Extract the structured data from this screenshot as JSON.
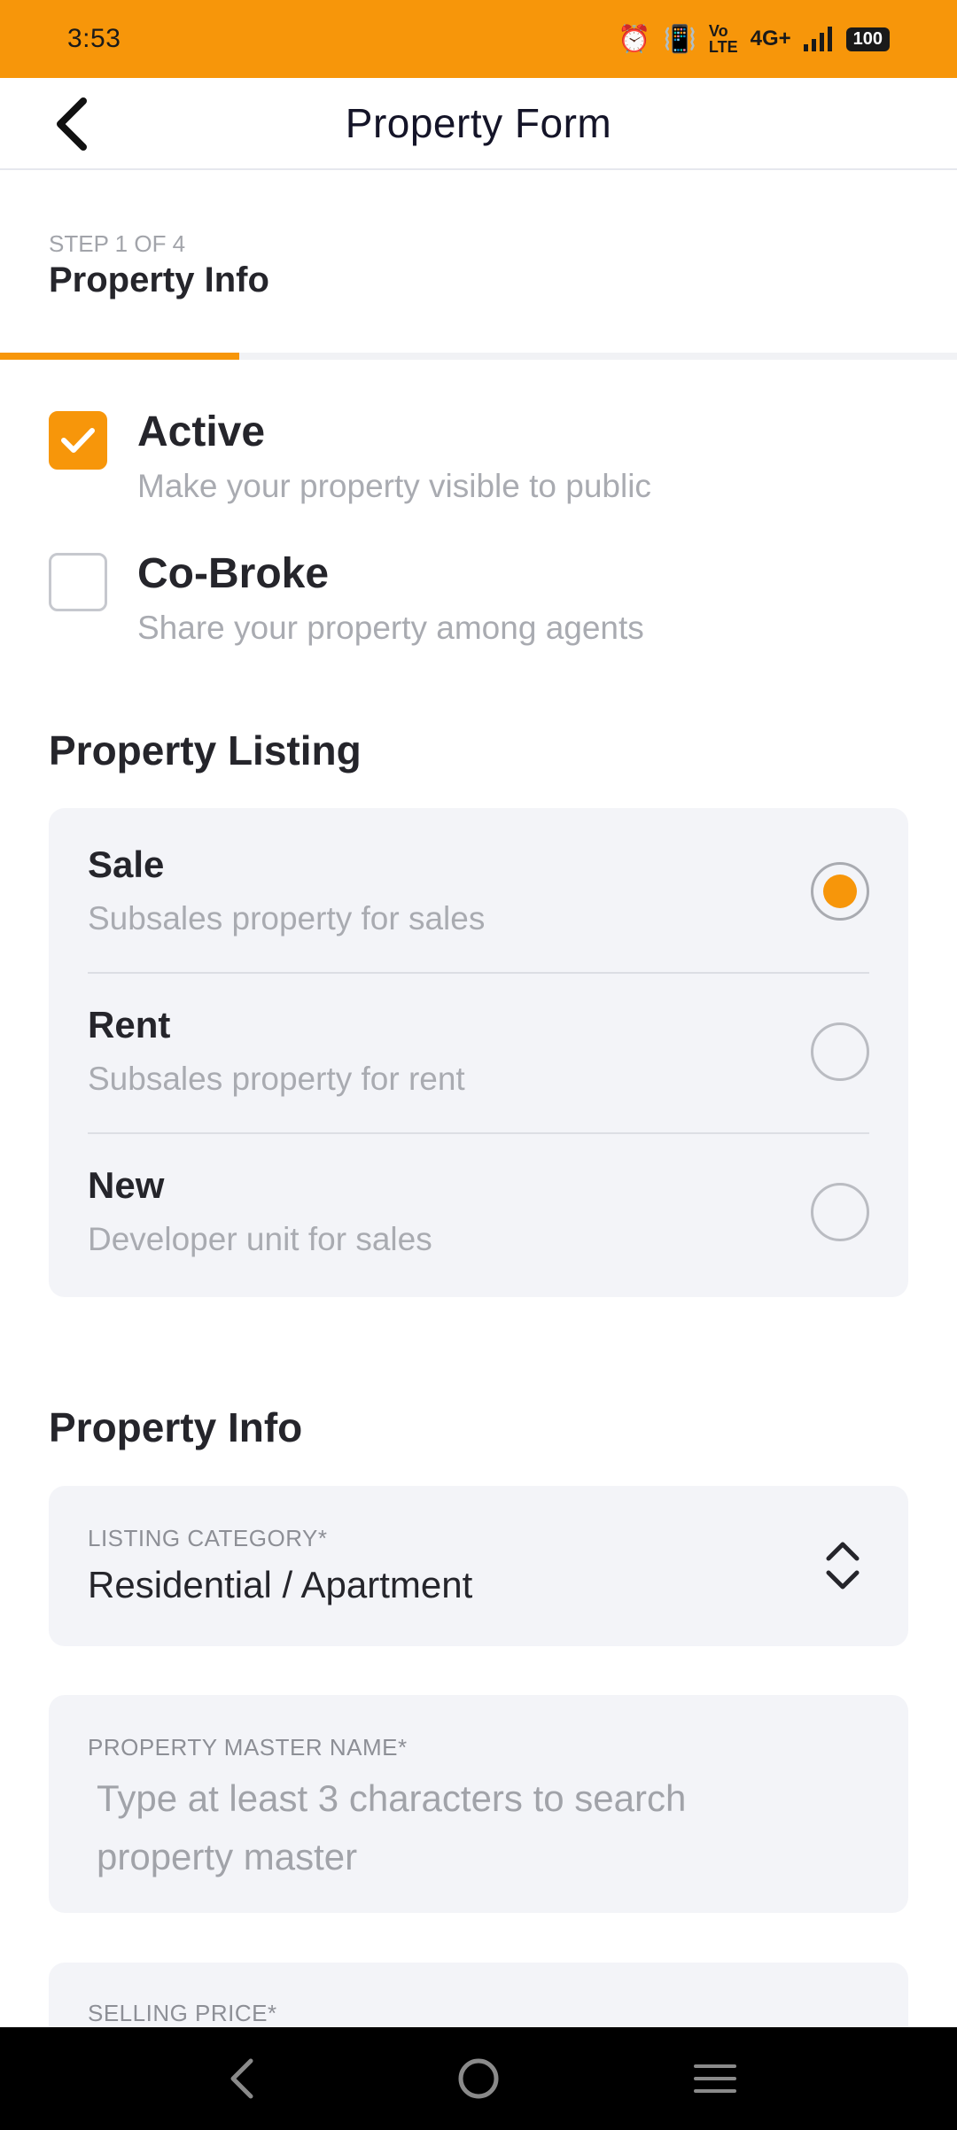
{
  "status_bar": {
    "time": "3:53",
    "network": "4G+",
    "battery": "100",
    "icons": [
      "alarm-icon",
      "vibrate-icon",
      "volte-icon",
      "signal-icon",
      "battery-icon"
    ]
  },
  "app_bar": {
    "title": "Property Form",
    "back_icon": "chevron-left-icon"
  },
  "step": {
    "label": "STEP 1 OF 4",
    "title": "Property Info",
    "progress_fraction": 0.25
  },
  "options": {
    "active": {
      "title": "Active",
      "subtitle": "Make your property visible to public",
      "checked": true
    },
    "cobroke": {
      "title": "Co-Broke",
      "subtitle": "Share your property among agents",
      "checked": false
    }
  },
  "listing": {
    "heading": "Property Listing",
    "items": [
      {
        "title": "Sale",
        "subtitle": "Subsales property for sales",
        "selected": true
      },
      {
        "title": "Rent",
        "subtitle": "Subsales property for rent",
        "selected": false
      },
      {
        "title": "New",
        "subtitle": "Developer unit for sales",
        "selected": false
      }
    ]
  },
  "info": {
    "heading": "Property Info",
    "category": {
      "label": "LISTING CATEGORY*",
      "value": "Residential / Apartment"
    },
    "master_name": {
      "label": "PROPERTY MASTER NAME*",
      "placeholder": "Type at least 3 characters to search property master"
    },
    "selling_price": {
      "label": "SELLING PRICE*"
    }
  },
  "colors": {
    "accent": "#f7960a",
    "card_bg": "#f3f4f8",
    "muted_text": "#a9abb1"
  }
}
